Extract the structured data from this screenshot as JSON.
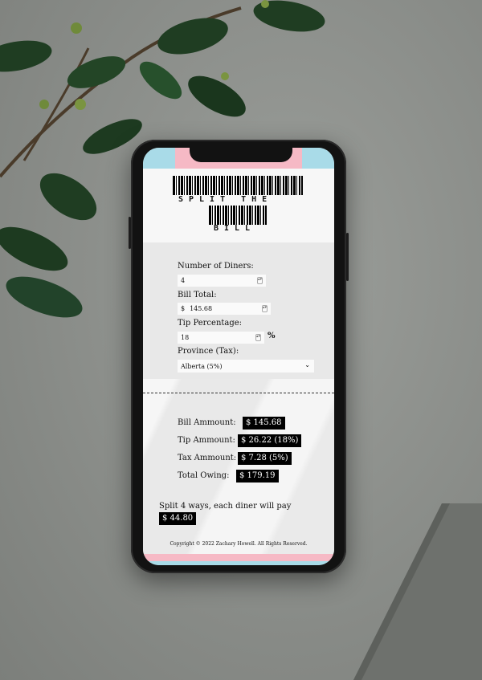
{
  "app": {
    "title_line1": "SPLIT THE",
    "title_line2": "BILL"
  },
  "form": {
    "diners_label": "Number of Diners:",
    "diners_value": "4",
    "bill_label": "Bill Total:",
    "bill_currency": "$",
    "bill_value": "145.68",
    "tip_label": "Tip Percentage:",
    "tip_value": "18",
    "tip_unit": "%",
    "province_label": "Province (Tax):",
    "province_value": "Alberta (5%)"
  },
  "results": {
    "bill_label": "Bill Ammount:",
    "bill_value": "$ 145.68",
    "tip_label": "Tip Ammount:",
    "tip_value": "$ 26.22 (18%)",
    "tax_label": "Tax Ammount:",
    "tax_value": "$ 7.28 (5%)",
    "total_label": "Total Owing:",
    "total_value": "$ 179.19",
    "split_text": "Split 4 ways, each diner will pay",
    "split_value": "$ 44.80"
  },
  "footer": {
    "copyright": "Copyright © 2022 Zachary Howell. All Rights Reserved."
  },
  "colors": {
    "pink": "#f6b9c5",
    "blue": "#a9dbe8",
    "badge": "#000000"
  }
}
